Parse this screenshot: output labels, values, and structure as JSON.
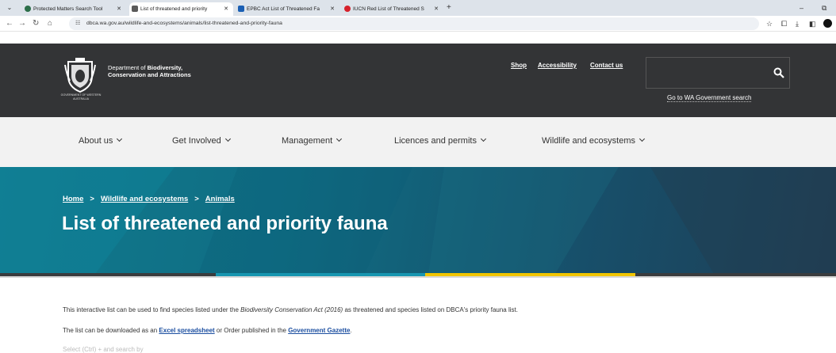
{
  "browser": {
    "tabs": [
      {
        "title": "Protected Matters Search Tool",
        "favicon_color": "#2c6e49"
      },
      {
        "title": "List of threatened and priority",
        "favicon_color": "#5a5a5a"
      },
      {
        "title": "EPBC Act List of Threatened Fa",
        "favicon_color": "#1a5fb4"
      },
      {
        "title": "IUCN Red List of Threatened S",
        "favicon_color": "#d6212b"
      }
    ],
    "url": "dbca.wa.gov.au/wildlife-and-ecosystems/animals/list-threatened-and-priority-fauna"
  },
  "header": {
    "crest_caption": "GOVERNMENT OF WESTERN AUSTRALIA",
    "brand_prefix": "Department of ",
    "brand_bold1": "Biodiversity,",
    "brand_line2": "Conservation and Attractions",
    "top_links": [
      "Shop",
      "Accessibility",
      "Contact us"
    ],
    "gov_search_link": "Go to WA Government search"
  },
  "nav": {
    "items": [
      "About us",
      "Get Involved",
      "Management",
      "Licences and permits",
      "Wildlife and ecosystems"
    ]
  },
  "hero": {
    "breadcrumb": [
      "Home",
      "Wildlife and ecosystems",
      "Animals"
    ],
    "breadcrumb_sep": ">",
    "title": "List of threatened and priority fauna"
  },
  "content": {
    "p1_before": "This interactive list can be used to find species listed under the ",
    "p1_em": "Biodiversity Conservation Act (2016)",
    "p1_after": " as threatened and species listed on DBCA's priority fauna list.",
    "p2_before": "The list can be downloaded as an ",
    "p2_link1": "Excel spreadsheet",
    "p2_middle": " or Order published in the ",
    "p2_link2": "Government Gazette",
    "p2_after": ".",
    "p3_partial": "Select (Ctrl) + and search by"
  },
  "colors": {
    "header_bg": "#333436",
    "nav_bg": "#f2f2f2",
    "hero_teal": "#117a8e",
    "stripe_teal": "#1796b0",
    "stripe_yellow": "#f1c500",
    "link": "#1b4ea0"
  }
}
